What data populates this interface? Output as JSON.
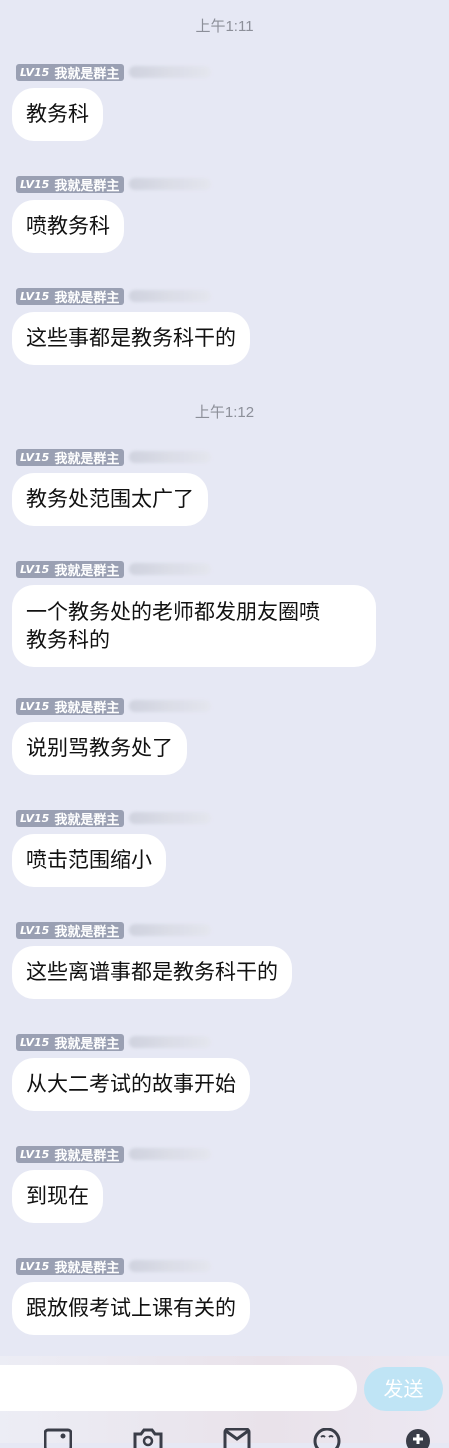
{
  "timestamps": [
    "上午1:11",
    "上午1:12"
  ],
  "sender": {
    "level": "LV15",
    "title": "我就是群主"
  },
  "messages": [
    {
      "text": "教务科"
    },
    {
      "text": "喷教务科"
    },
    {
      "text": "这些事都是教务科干的"
    },
    {
      "text": "教务处范围太广了"
    },
    {
      "line1": "一个教务处的老师都发朋友圈喷",
      "line2": "教务科的"
    },
    {
      "text": "说别骂教务处了"
    },
    {
      "text": "喷击范围缩小"
    },
    {
      "text": "这些离谱事都是教务科干的"
    },
    {
      "text": "从大二考试的故事开始"
    },
    {
      "text": "到现在"
    },
    {
      "text": "跟放假考试上课有关的"
    }
  ],
  "input": {
    "send_label": "发送",
    "value": ""
  },
  "toolbar": {
    "icons": [
      "image-icon",
      "camera-icon",
      "red-packet-icon",
      "emoji-icon",
      "plus-icon"
    ]
  },
  "colors": {
    "background": "#e6e8f4",
    "bubble": "#ffffff",
    "badge": "#9aa0b3",
    "send_button": "#bfe4f5"
  }
}
